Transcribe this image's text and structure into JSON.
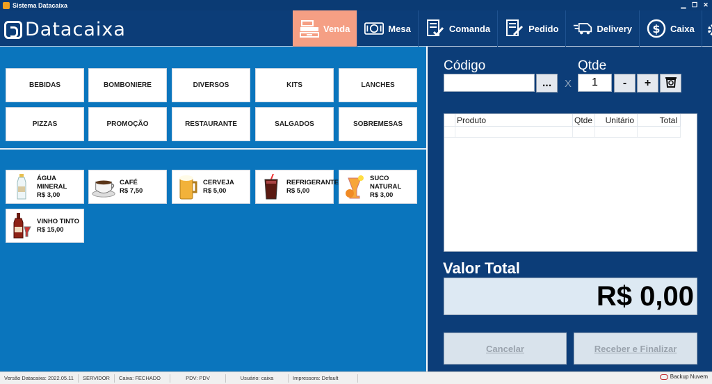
{
  "window": {
    "title": "Sistema Datacaixa"
  },
  "logo": {
    "text": "Datacaixa"
  },
  "nav": [
    {
      "label": "Venda",
      "icon": "cash-register-icon",
      "active": true
    },
    {
      "label": "Mesa",
      "icon": "table-dining-icon"
    },
    {
      "label": "Comanda",
      "icon": "order-list-icon"
    },
    {
      "label": "Pedido",
      "icon": "order-edit-icon"
    },
    {
      "label": "Delivery",
      "icon": "delivery-truck-icon"
    },
    {
      "label": "Caixa",
      "icon": "dollar-circle-icon"
    }
  ],
  "categories": [
    "BEBIDAS",
    "BOMBONIERE",
    "DIVERSOS",
    "KITS",
    "LANCHES",
    "PIZZAS",
    "PROMOÇÃO",
    "RESTAURANTE",
    "SALGADOS",
    "SOBREMESAS"
  ],
  "products": [
    {
      "name": "ÁGUA MINERAL",
      "price": "R$ 3,00",
      "icon": "water-bottle-icon"
    },
    {
      "name": "CAFÉ",
      "price": "R$ 7,50",
      "icon": "coffee-cup-icon"
    },
    {
      "name": "CERVEJA",
      "price": "R$ 5,00",
      "icon": "beer-mug-icon"
    },
    {
      "name": "REFRIGERANTE",
      "price": "R$ 5,00",
      "icon": "soda-glass-icon"
    },
    {
      "name": "SUCO NATURAL",
      "price": "R$ 3,00",
      "icon": "juice-glass-icon"
    },
    {
      "name": "VINHO TINTO",
      "price": "R$ 15,00",
      "icon": "wine-bottle-icon"
    }
  ],
  "right": {
    "codigo_label": "Código",
    "codigo_value": "",
    "browse_label": "...",
    "x_label": "X",
    "qtde_label": "Qtde",
    "qtde_value": "1",
    "minus_label": "-",
    "plus_label": "+",
    "grid_headers": [
      "Produto",
      "Qtde",
      "Unitário",
      "Total"
    ],
    "valor_total_label": "Valor Total",
    "valor_total_value": "R$ 0,00",
    "cancel_label": "Cancelar",
    "finish_label": "Receber e Finalizar"
  },
  "status": {
    "version": "Versão Datacaixa: 2022.05.11",
    "server": "SERVIDOR",
    "caixa": "Caixa: FECHADO",
    "pdv": "PDV: PDV",
    "usuario": "Usuário: caixa",
    "impressora": "Impressora: Default",
    "backup": "Backup Nuvem"
  },
  "colors": {
    "accent": "#f59f84",
    "header": "#0c3d78",
    "left_bg": "#0a75bd"
  }
}
